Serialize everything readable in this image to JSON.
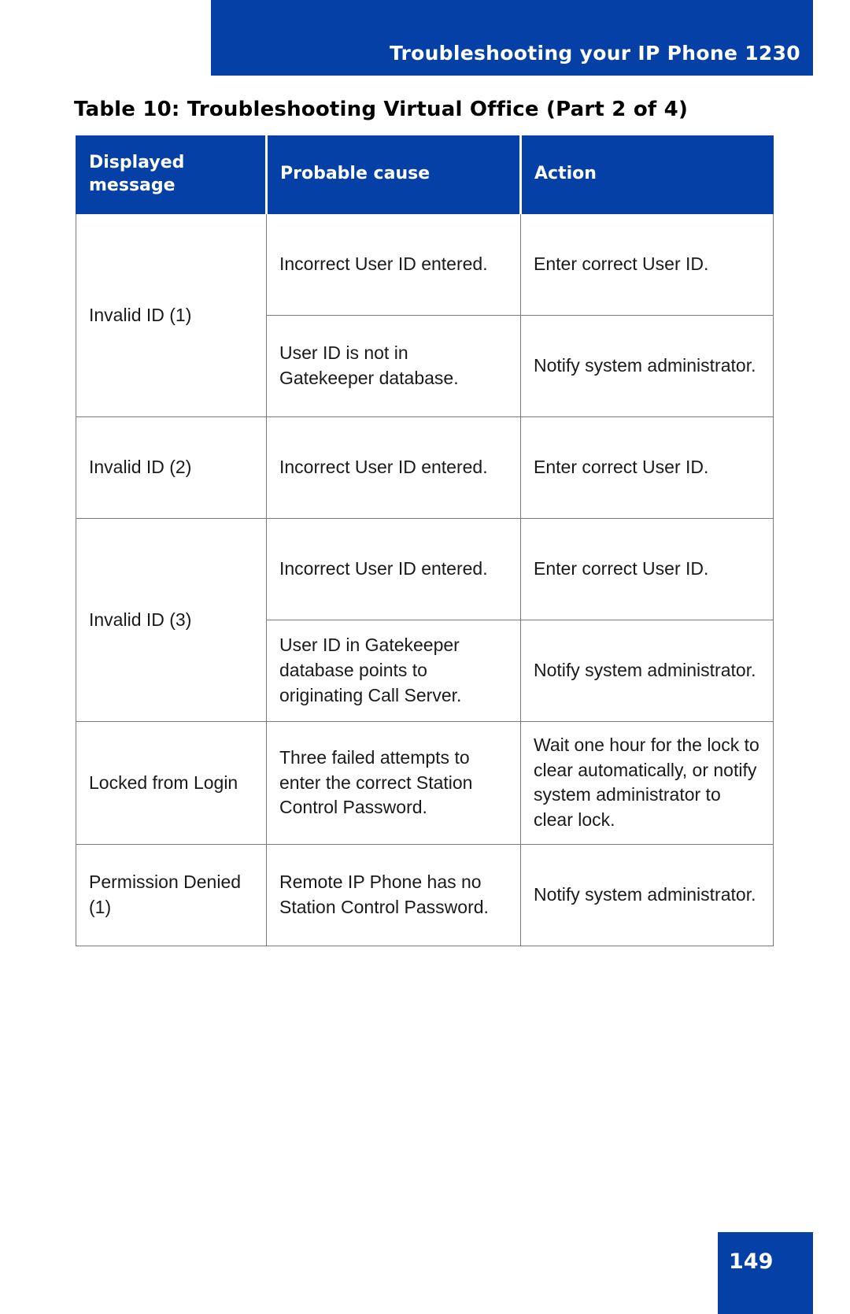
{
  "header": {
    "running_title": "Troubleshooting your IP Phone 1230",
    "banner_color": "#0540a6"
  },
  "caption": {
    "text": "Table 10: Troubleshooting Virtual Office (Part 2 of 4)"
  },
  "table": {
    "columns": [
      {
        "header": "Displayed message"
      },
      {
        "header": "Probable cause"
      },
      {
        "header": "Action"
      }
    ],
    "rows": [
      {
        "displayed_message": "Invalid ID (1)",
        "entries": [
          {
            "probable_cause": "Incorrect User ID entered.",
            "action": "Enter correct User ID."
          },
          {
            "probable_cause": "User ID is not in Gatekeeper database.",
            "action": "Notify system administrator."
          }
        ]
      },
      {
        "displayed_message": "Invalid ID (2)",
        "entries": [
          {
            "probable_cause": "Incorrect User ID entered.",
            "action": "Enter correct User ID."
          }
        ]
      },
      {
        "displayed_message": "Invalid ID (3)",
        "entries": [
          {
            "probable_cause": "Incorrect User ID entered.",
            "action": "Enter correct User ID."
          },
          {
            "probable_cause": "User ID in Gatekeeper database points to originating Call Server.",
            "action": "Notify system administrator."
          }
        ]
      },
      {
        "displayed_message": "Locked from Login",
        "entries": [
          {
            "probable_cause": "Three failed attempts to enter the correct Station Control Password.",
            "action": "Wait one hour for the lock to clear automatically, or notify system administrator to clear lock."
          }
        ]
      },
      {
        "displayed_message": "Permission Denied (1)",
        "entries": [
          {
            "probable_cause": "Remote IP Phone has no Station Control Password.",
            "action": "Notify system administrator."
          }
        ]
      }
    ]
  },
  "footer": {
    "page_number": "149",
    "box_color": "#0540a6"
  }
}
